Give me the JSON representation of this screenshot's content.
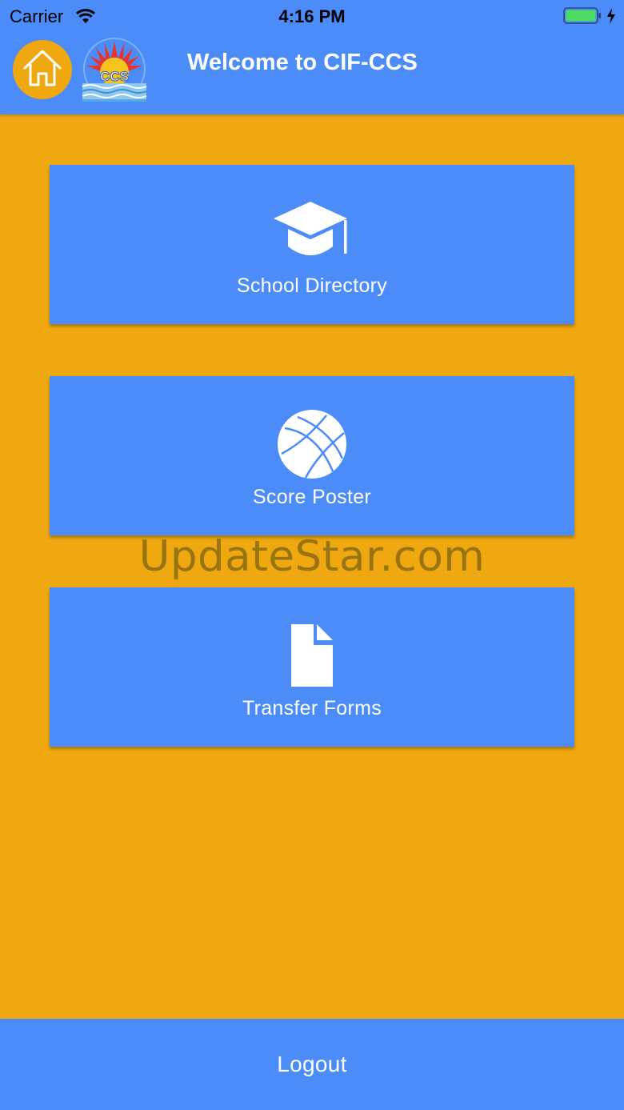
{
  "status_bar": {
    "carrier": "Carrier",
    "time": "4:16 PM"
  },
  "header": {
    "title": "Welcome to CIF-CCS",
    "logo_text": "CCS"
  },
  "menu": [
    {
      "label": "School Directory",
      "icon": "graduation-cap-icon"
    },
    {
      "label": "Score Poster",
      "icon": "basketball-icon"
    },
    {
      "label": "Transfer Forms",
      "icon": "document-icon"
    }
  ],
  "watermark": "UpdateStar.com",
  "footer": {
    "logout_label": "Logout"
  },
  "colors": {
    "primary": "#4B8CF8",
    "background": "#EFA810",
    "text": "#FFFFFF"
  }
}
